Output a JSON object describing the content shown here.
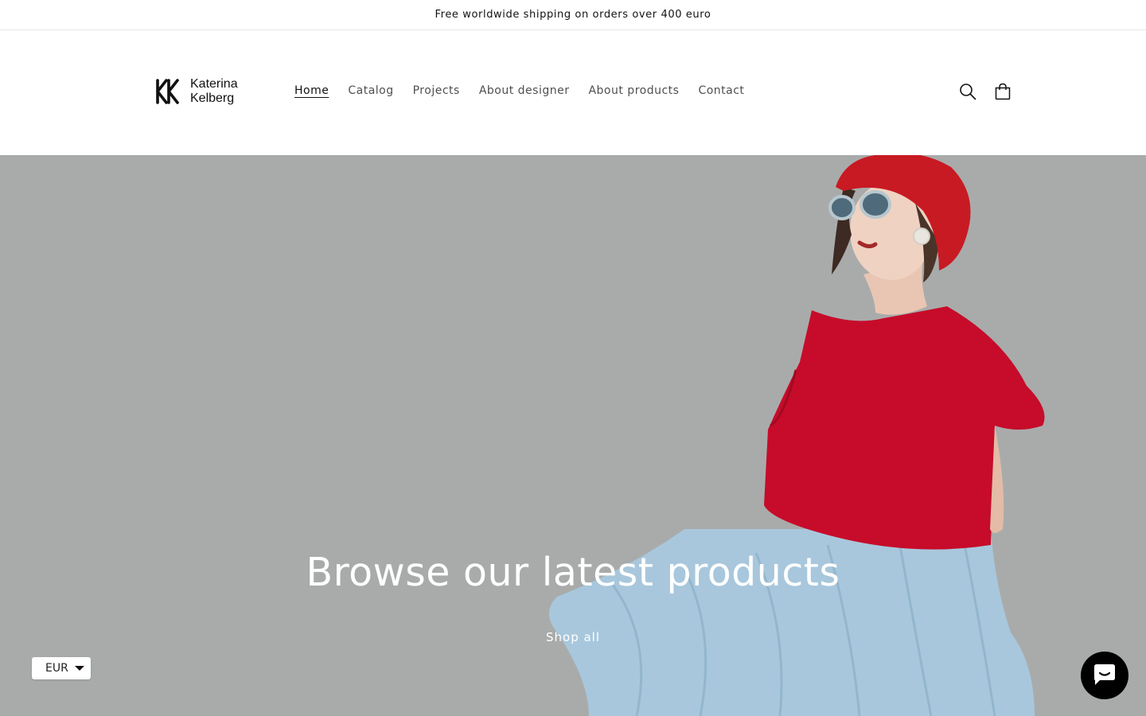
{
  "announcement": {
    "text": "Free worldwide shipping on orders over 400 euro"
  },
  "header": {
    "logo": {
      "line1": "Katerina",
      "line2": "Kelberg",
      "mark": "KK"
    },
    "nav": [
      {
        "label": "Home",
        "active": true
      },
      {
        "label": "Catalog"
      },
      {
        "label": "Projects"
      },
      {
        "label": "About designer"
      },
      {
        "label": "About products"
      },
      {
        "label": "Contact"
      }
    ],
    "icons": {
      "search": "search-icon",
      "cart": "cart-icon"
    }
  },
  "hero": {
    "title": "Browse our latest products",
    "link": "Shop all",
    "colors": {
      "background": "#a9abab",
      "top": "#c8102e",
      "skirt": "#a8c7dc",
      "hat": "#c81a22"
    }
  },
  "currency": {
    "value": "EUR"
  },
  "chat": {
    "icon": "chat-icon"
  }
}
